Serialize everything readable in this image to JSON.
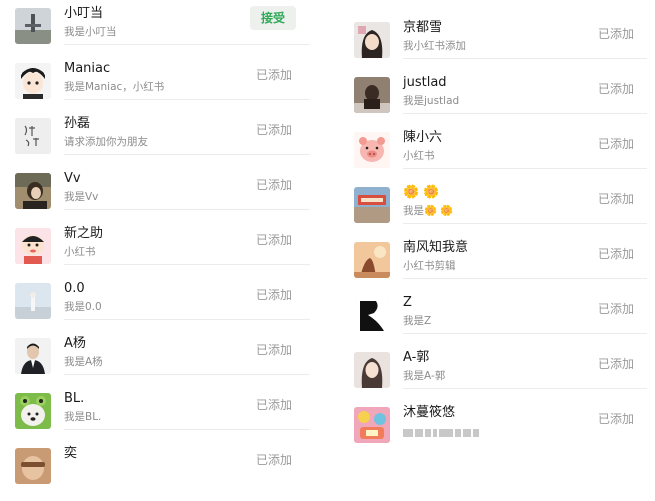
{
  "left": [
    {
      "name": "小叮当",
      "sub": "我是小叮当",
      "action": "接受",
      "avatar": "avatar-photo-tower"
    },
    {
      "name": "Maniac",
      "sub": "我是Maniac，小红书",
      "action": "已添加",
      "avatar": "avatar-anime-boy"
    },
    {
      "name": "孙磊",
      "sub": "请求添加你为朋友",
      "action": "已添加",
      "avatar": "avatar-calligraphy"
    },
    {
      "name": "Vv",
      "sub": "我是Vv",
      "action": "已添加",
      "avatar": "avatar-photo-girl"
    },
    {
      "name": "新之助",
      "sub": "小红书",
      "action": "已添加",
      "avatar": "avatar-cartoon-kid"
    },
    {
      "name": "0.0",
      "sub": "我是0.0",
      "action": "已添加",
      "avatar": "avatar-photo-sky"
    },
    {
      "name": "A杨",
      "sub": "我是A杨",
      "action": "已添加",
      "avatar": "avatar-photo-man"
    },
    {
      "name": "BL.",
      "sub": "我是BL.",
      "action": "已添加",
      "avatar": "avatar-dog-frog-hat"
    },
    {
      "name": "奕",
      "sub": "",
      "action": "已添加",
      "avatar": "avatar-photo-face"
    }
  ],
  "right": [
    {
      "name": "京都雪",
      "sub": "我小红书添加",
      "action": "已添加",
      "avatar": "avatar-photo-portrait"
    },
    {
      "name": "justlad",
      "sub": "我是justlad",
      "action": "已添加",
      "avatar": "avatar-photo-dark"
    },
    {
      "name": "陳小六",
      "sub": "小红书",
      "action": "已添加",
      "avatar": "avatar-cartoon-pig"
    },
    {
      "name": "🌼 🌼",
      "sub": "我是🌼 🌼",
      "action": "已添加",
      "avatar": "avatar-photo-street"
    },
    {
      "name": "南风知我意",
      "sub": "小红书剪辑",
      "action": "已添加",
      "avatar": "avatar-photo-sunset"
    },
    {
      "name": "Z",
      "sub": "我是Z",
      "action": "已添加",
      "avatar": "avatar-black-shape"
    },
    {
      "name": "A-郭",
      "sub": "我是A-郭",
      "action": "已添加",
      "avatar": "avatar-photo-woman"
    },
    {
      "name": "沐蔓筱悠",
      "sub": "",
      "action": "已添加",
      "avatar": "avatar-colorful-art"
    }
  ],
  "colors": {
    "accept_text": "#2faa57",
    "accept_bg": "#eef0ee",
    "status": "#9a9a9a",
    "divider": "#ececec"
  }
}
